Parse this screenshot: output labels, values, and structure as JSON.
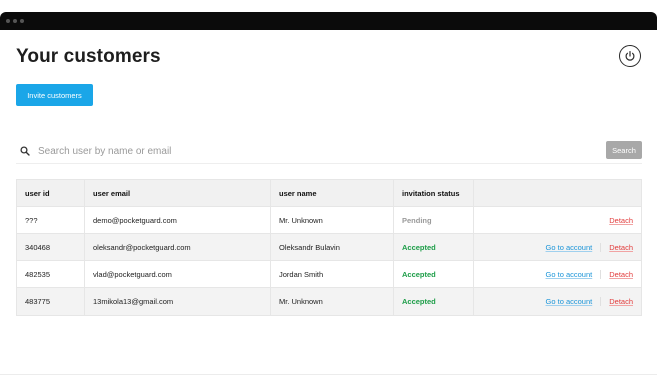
{
  "page": {
    "title": "Your customers",
    "invite_label": "Invite customers",
    "power_icon": "power-icon"
  },
  "search": {
    "placeholder": "Search user by name or email",
    "value": "",
    "button_label": "Search",
    "icon": "search-icon"
  },
  "table": {
    "headers": [
      "user id",
      "user email",
      "user name",
      "invitation status",
      ""
    ],
    "rows": [
      {
        "id": "???",
        "email": "demo@pocketguard.com",
        "name": "Mr. Unknown",
        "status": "Pending",
        "status_type": "pending",
        "account_link": "",
        "detach": "Detach"
      },
      {
        "id": "340468",
        "email": "oleksandr@pocketguard.com",
        "name": "Oleksandr Bulavin",
        "status": "Accepted",
        "status_type": "accepted",
        "account_link": "Go to account",
        "detach": "Detach"
      },
      {
        "id": "482535",
        "email": "vlad@pocketguard.com",
        "name": "Jordan Smith",
        "status": "Accepted",
        "status_type": "accepted",
        "account_link": "Go to account",
        "detach": "Detach"
      },
      {
        "id": "483775",
        "email": "13mikola13@gmail.com",
        "name": "Mr. Unknown",
        "status": "Accepted",
        "status_type": "accepted",
        "account_link": "Go to account",
        "detach": "Detach"
      }
    ]
  },
  "colors": {
    "accent": "#1aa6e8",
    "accepted": "#1e9e49",
    "pending": "#9a9a9a",
    "link": "#1a94d8",
    "danger": "#e23b3b",
    "titlebar": "#0b0b0b"
  }
}
